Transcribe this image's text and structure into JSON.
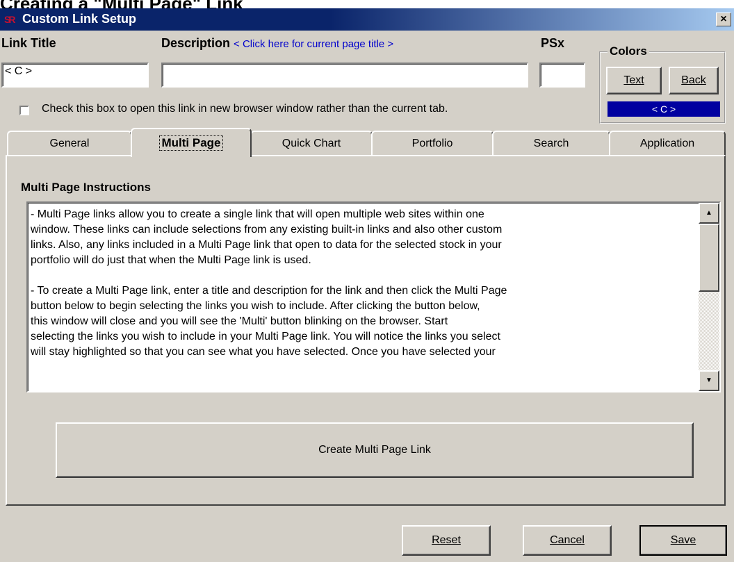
{
  "page_heading": "Creating a \"Multi Page\" Link",
  "window": {
    "title": "Custom Link Setup",
    "icon": "sr-app-icon",
    "close_glyph": "×"
  },
  "fields": {
    "link_title_label": "Link Title",
    "link_title_value": "< C >",
    "description_label": "Description",
    "description_hint": "< Click here for current page title >",
    "description_value": "",
    "psx_label": "PSx",
    "psx_value": ""
  },
  "checkbox": {
    "label": "Check this box to open this link in new browser window rather than the current tab.",
    "checked": false
  },
  "colors": {
    "group_title": "Colors",
    "text_button": "Text",
    "back_button": "Back",
    "sample_text": "< C >",
    "sample_bg": "#0000a0",
    "sample_fg": "#ffffff"
  },
  "tabs": [
    {
      "label": "General",
      "active": false
    },
    {
      "label": "Multi Page",
      "active": true
    },
    {
      "label": "Quick Chart",
      "active": false
    },
    {
      "label": "Portfolio",
      "active": false
    },
    {
      "label": "Search",
      "active": false
    },
    {
      "label": "Application",
      "active": false
    }
  ],
  "panel": {
    "instructions_title": "Multi Page Instructions",
    "paragraph_1_lines": [
      "- Multi Page links allow you to create a single link that will open multiple web sites within one",
      "window.  These links can include selections from any existing built-in links and also other custom",
      "links.  Also, any links included in a Multi Page link that open to data for the selected stock in your",
      "portfolio will do just that when the Multi Page link is used."
    ],
    "paragraph_2_lines": [
      "- To create a Multi Page link,  enter a title and description for the link and then click the Multi Page",
      "button below to begin selecting the links you wish to include.  After clicking the button below,",
      "this window will close and you will see the 'Multi' button blinking on the browser.  Start",
      "selecting the links you wish to include in your Multi Page link.  You will notice the links you select",
      "will stay highlighted so that you can see what you have selected.  Once you have selected your"
    ],
    "create_button": "Create Multi Page Link"
  },
  "footer": {
    "reset_button": "Reset",
    "cancel_button": "Cancel",
    "save_button": "Save"
  }
}
